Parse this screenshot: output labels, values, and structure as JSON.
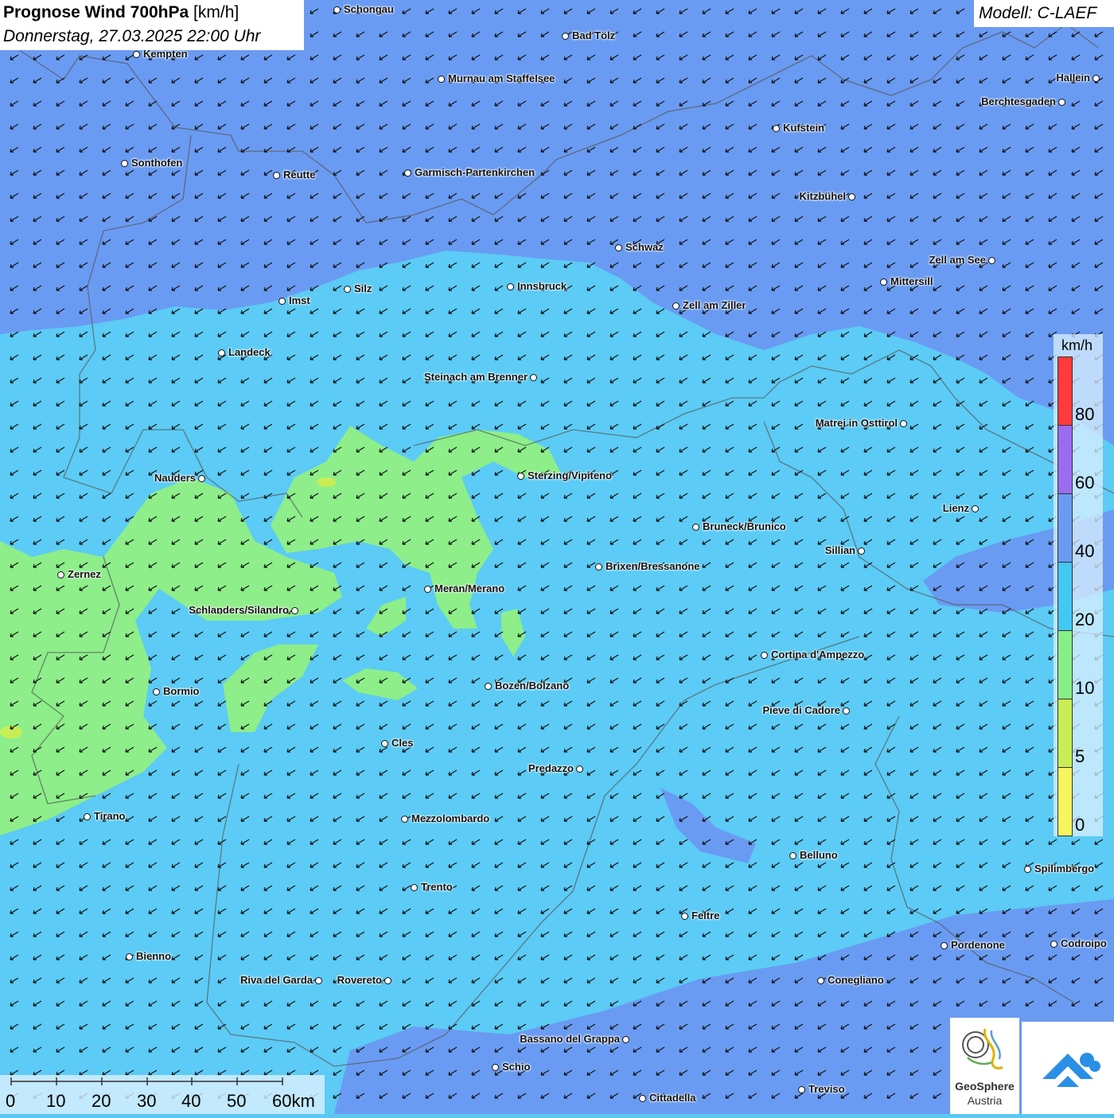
{
  "header": {
    "title_bold": "Prognose Wind 700hPa",
    "title_unit": "[km/h]",
    "datetime": "Donnerstag, 27.03.2025 22:00 Uhr"
  },
  "model": {
    "label": "Modell: C-LAEF"
  },
  "legend": {
    "unit": "km/h",
    "ticks": [
      "80",
      "60",
      "40",
      "20",
      "10",
      "5",
      "0"
    ],
    "colors": [
      "#ff3b3b",
      "#9b6cf0",
      "#6a9bf2",
      "#42c8f2",
      "#88ee88",
      "#c8ee55",
      "#f5f560"
    ]
  },
  "scalebar": {
    "labels": [
      "0",
      "10",
      "20",
      "30",
      "40",
      "50",
      "60km"
    ]
  },
  "logos": {
    "geosphere_line1": "GeoSphere",
    "geosphere_line2": "Austria"
  },
  "cities": [
    {
      "name": "Schongau",
      "side": "r"
    },
    {
      "name": "Bad Tölz",
      "side": "r"
    },
    {
      "name": "Kempten",
      "side": "r"
    },
    {
      "name": "Murnau am Staffelsee",
      "side": "r"
    },
    {
      "name": "Hallein",
      "side": "l"
    },
    {
      "name": "Berchtesgaden",
      "side": "l"
    },
    {
      "name": "Kufstein",
      "side": "r"
    },
    {
      "name": "Sonthofen",
      "side": "r"
    },
    {
      "name": "Reutte",
      "side": "r"
    },
    {
      "name": "Garmisch-Partenkirchen",
      "side": "r"
    },
    {
      "name": "Kitzbühel",
      "side": "l"
    },
    {
      "name": "Schwaz",
      "side": "r"
    },
    {
      "name": "Zell am See",
      "side": "l"
    },
    {
      "name": "Innsbruck",
      "side": "r"
    },
    {
      "name": "Silz",
      "side": "r"
    },
    {
      "name": "Mittersill",
      "side": "r"
    },
    {
      "name": "Imst",
      "side": "r"
    },
    {
      "name": "Zell am Ziller",
      "side": "r"
    },
    {
      "name": "Landeck",
      "side": "r"
    },
    {
      "name": "Steinach am Brenner",
      "side": "l"
    },
    {
      "name": "Matrei in Osttirol",
      "side": "l"
    },
    {
      "name": "Nauders",
      "side": "l"
    },
    {
      "name": "Sterzing/Vipiteno",
      "side": "r"
    },
    {
      "name": "Lienz",
      "side": "l"
    },
    {
      "name": "Bruneck/Brunico",
      "side": "r"
    },
    {
      "name": "Sillian",
      "side": "l"
    },
    {
      "name": "Zernez",
      "side": "r"
    },
    {
      "name": "Brixen/Bressanone",
      "side": "r"
    },
    {
      "name": "Meran/Merano",
      "side": "r"
    },
    {
      "name": "Schlanders/Silandro",
      "side": "l"
    },
    {
      "name": "Cortina d'Ampezzo",
      "side": "r"
    },
    {
      "name": "Bozen/Bolzano",
      "side": "r"
    },
    {
      "name": "Bormio",
      "side": "r"
    },
    {
      "name": "Pieve di Cadore",
      "side": "l"
    },
    {
      "name": "Cles",
      "side": "r"
    },
    {
      "name": "Predazzo",
      "side": "l"
    },
    {
      "name": "Tirano",
      "side": "r"
    },
    {
      "name": "Mezzolombardo",
      "side": "r"
    },
    {
      "name": "Belluno",
      "side": "r"
    },
    {
      "name": "Spilimbergo",
      "side": "r"
    },
    {
      "name": "Trento",
      "side": "r"
    },
    {
      "name": "Feltre",
      "side": "r"
    },
    {
      "name": "Pordenone",
      "side": "r"
    },
    {
      "name": "Codroipo",
      "side": "r"
    },
    {
      "name": "Bienno",
      "side": "r"
    },
    {
      "name": "Riva del Garda",
      "side": "l"
    },
    {
      "name": "Rovereto",
      "side": "l"
    },
    {
      "name": "Conegliano",
      "side": "r"
    },
    {
      "name": "Bassano del Grappa",
      "side": "l"
    },
    {
      "name": "Schio",
      "side": "r"
    },
    {
      "name": "Treviso",
      "side": "r"
    },
    {
      "name": "Cittadella",
      "side": "r"
    }
  ]
}
